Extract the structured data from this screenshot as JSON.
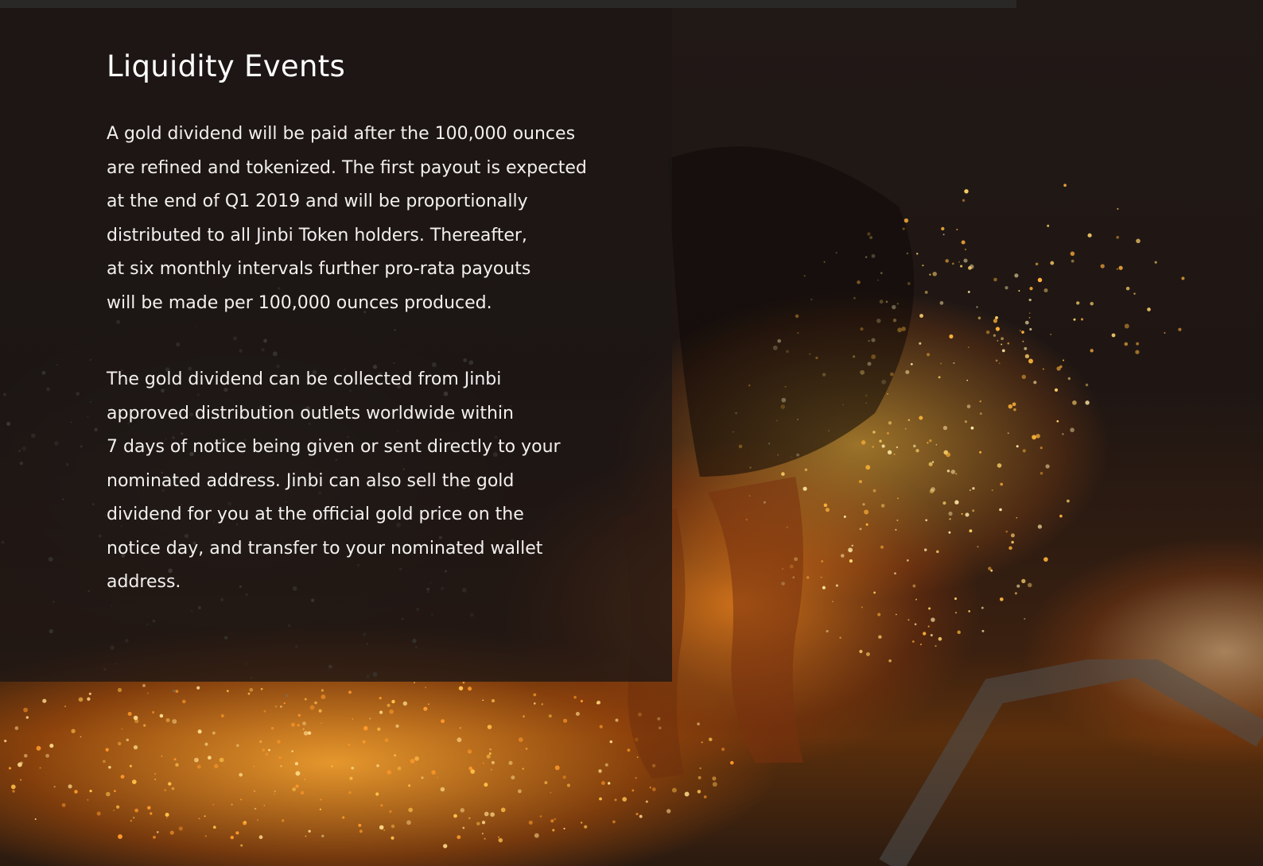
{
  "section": {
    "title": "Liquidity Events",
    "paragraph_1": "A gold dividend will be paid after the 100,000 ounces\nare refined and tokenized. The first payout is expected\nat the end of Q1 2019 and will be proportionally\ndistributed to all Jinbi Token holders. Thereafter,\nat six monthly intervals further pro-rata payouts\nwill be made per 100,000 ounces produced.",
    "paragraph_2": "The gold dividend can be collected from Jinbi\napproved distribution outlets worldwide within\n7 days of notice being given or sent directly to your\nnominated address. Jinbi can also sell the gold\ndividend for you at the official gold price on the\nnotice day, and transfer to your nominated wallet\naddress."
  },
  "background": {
    "image": "fire-walker-sparks-photo",
    "accent_color": "#f5a623",
    "panel_color": "#1c1614"
  }
}
